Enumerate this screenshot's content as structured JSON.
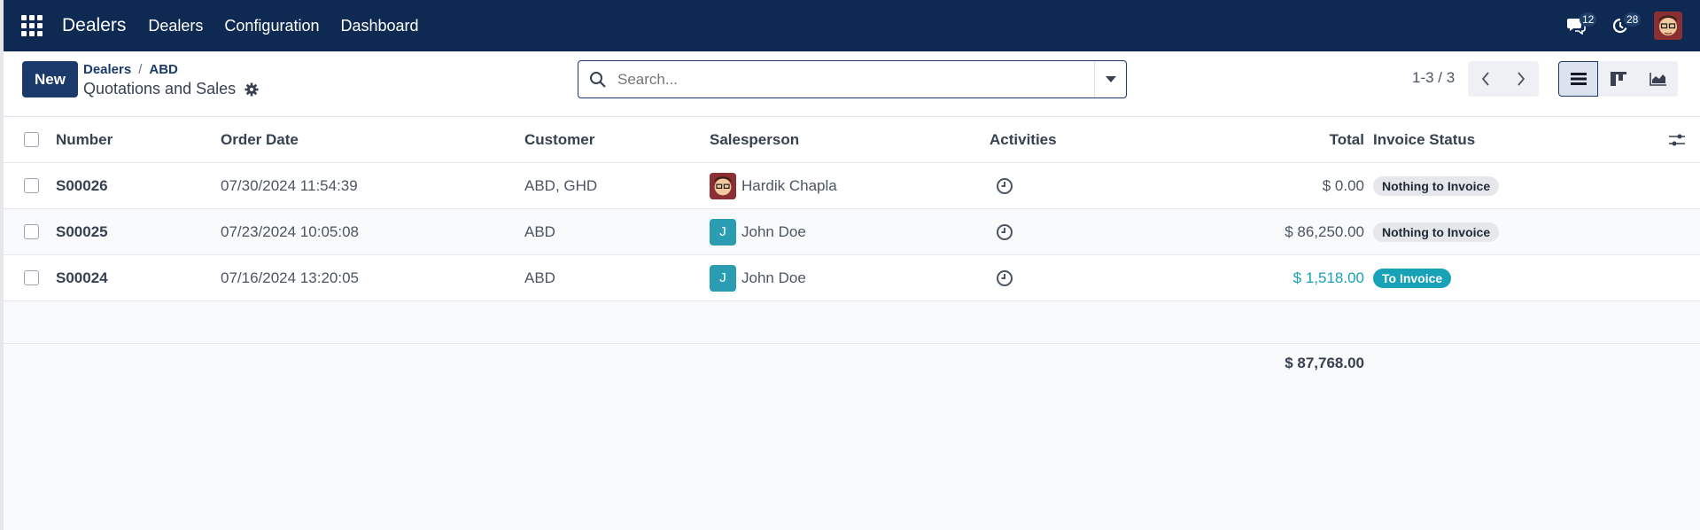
{
  "navbar": {
    "app_name": "Dealers",
    "menu": [
      "Dealers",
      "Configuration",
      "Dashboard"
    ],
    "messages_count": "12",
    "activities_count": "28",
    "bg_color": "#0f2a52"
  },
  "control_panel": {
    "new_label": "New",
    "breadcrumb": [
      "Dealers",
      "ABD"
    ],
    "view_title": "Quotations and Sales",
    "search_placeholder": "Search...",
    "pager": "1-3 / 3"
  },
  "table": {
    "columns": [
      "Number",
      "Order Date",
      "Customer",
      "Salesperson",
      "Activities",
      "Total",
      "Invoice Status"
    ],
    "rows": [
      {
        "number": "S00026",
        "order_date": "07/30/2024 11:54:39",
        "customer": "ABD, GHD",
        "salesperson": "Hardik Chapla",
        "salesperson_avatar": "photo",
        "total": "$ 0.00",
        "invoice_status": "Nothing to Invoice"
      },
      {
        "number": "S00025",
        "order_date": "07/23/2024 10:05:08",
        "customer": "ABD",
        "salesperson": "John Doe",
        "salesperson_avatar": "J",
        "total": "$ 86,250.00",
        "invoice_status": "Nothing to Invoice"
      },
      {
        "number": "S00024",
        "order_date": "07/16/2024 13:20:05",
        "customer": "ABD",
        "salesperson": "John Doe",
        "salesperson_avatar": "J",
        "total": "$ 1,518.00",
        "invoice_status": "To Invoice"
      }
    ],
    "grand_total": "$ 87,768.00"
  },
  "colors": {
    "primary": "#1b3a6b",
    "info": "#17a2b8"
  }
}
